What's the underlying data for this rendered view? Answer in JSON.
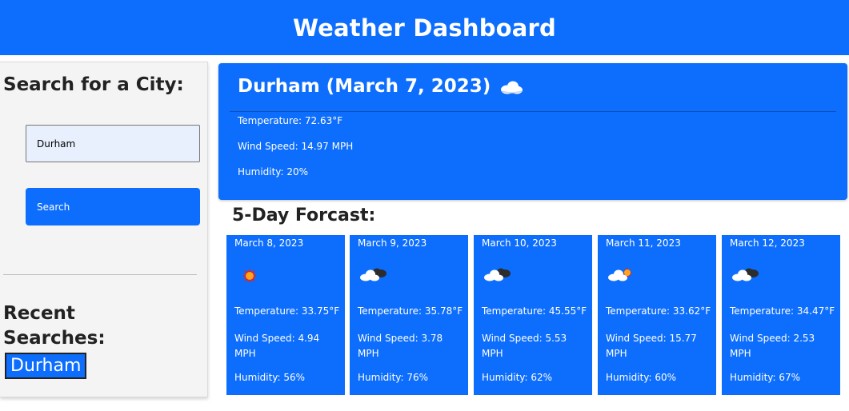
{
  "header": {
    "title": "Weather Dashboard"
  },
  "sidebar": {
    "search_title": "Search for a City:",
    "search_input_value": "Durham",
    "search_button_label": "Search",
    "recent_title": "Recent Searches:",
    "recent_items": [
      "Durham"
    ]
  },
  "current": {
    "title": "Durham (March 7, 2023)",
    "icon": "cloud-icon",
    "temperature": "Temperature: 72.63°F",
    "wind": "Wind Speed: 14.97 MPH",
    "humidity": "Humidity: 20%"
  },
  "forecast": {
    "title": "5-Day Forcast:",
    "days": [
      {
        "date": "March 8, 2023",
        "icon": "sun-icon",
        "temp": "Temperature: 33.75°F",
        "wind": "Wind Speed: 4.94 MPH",
        "humidity": "Humidity: 56%"
      },
      {
        "date": "March 9, 2023",
        "icon": "dark-cloud-icon",
        "temp": "Temperature: 35.78°F",
        "wind": "Wind Speed: 3.78 MPH",
        "humidity": "Humidity: 76%"
      },
      {
        "date": "March 10, 2023",
        "icon": "dark-cloud-icon",
        "temp": "Temperature: 45.55°F",
        "wind": "Wind Speed: 5.53 MPH",
        "humidity": "Humidity: 62%"
      },
      {
        "date": "March 11, 2023",
        "icon": "cloud-sun-icon",
        "temp": "Temperature: 33.62°F",
        "wind": "Wind Speed: 15.77 MPH",
        "humidity": "Humidity: 60%"
      },
      {
        "date": "March 12, 2023",
        "icon": "dark-cloud-icon",
        "temp": "Temperature: 34.47°F",
        "wind": "Wind Speed: 2.53 MPH",
        "humidity": "Humidity: 67%"
      }
    ]
  },
  "colors": {
    "accent": "#0d6efd",
    "sidebar_bg": "#f4f4f4",
    "input_bg": "#e8f0fe"
  }
}
